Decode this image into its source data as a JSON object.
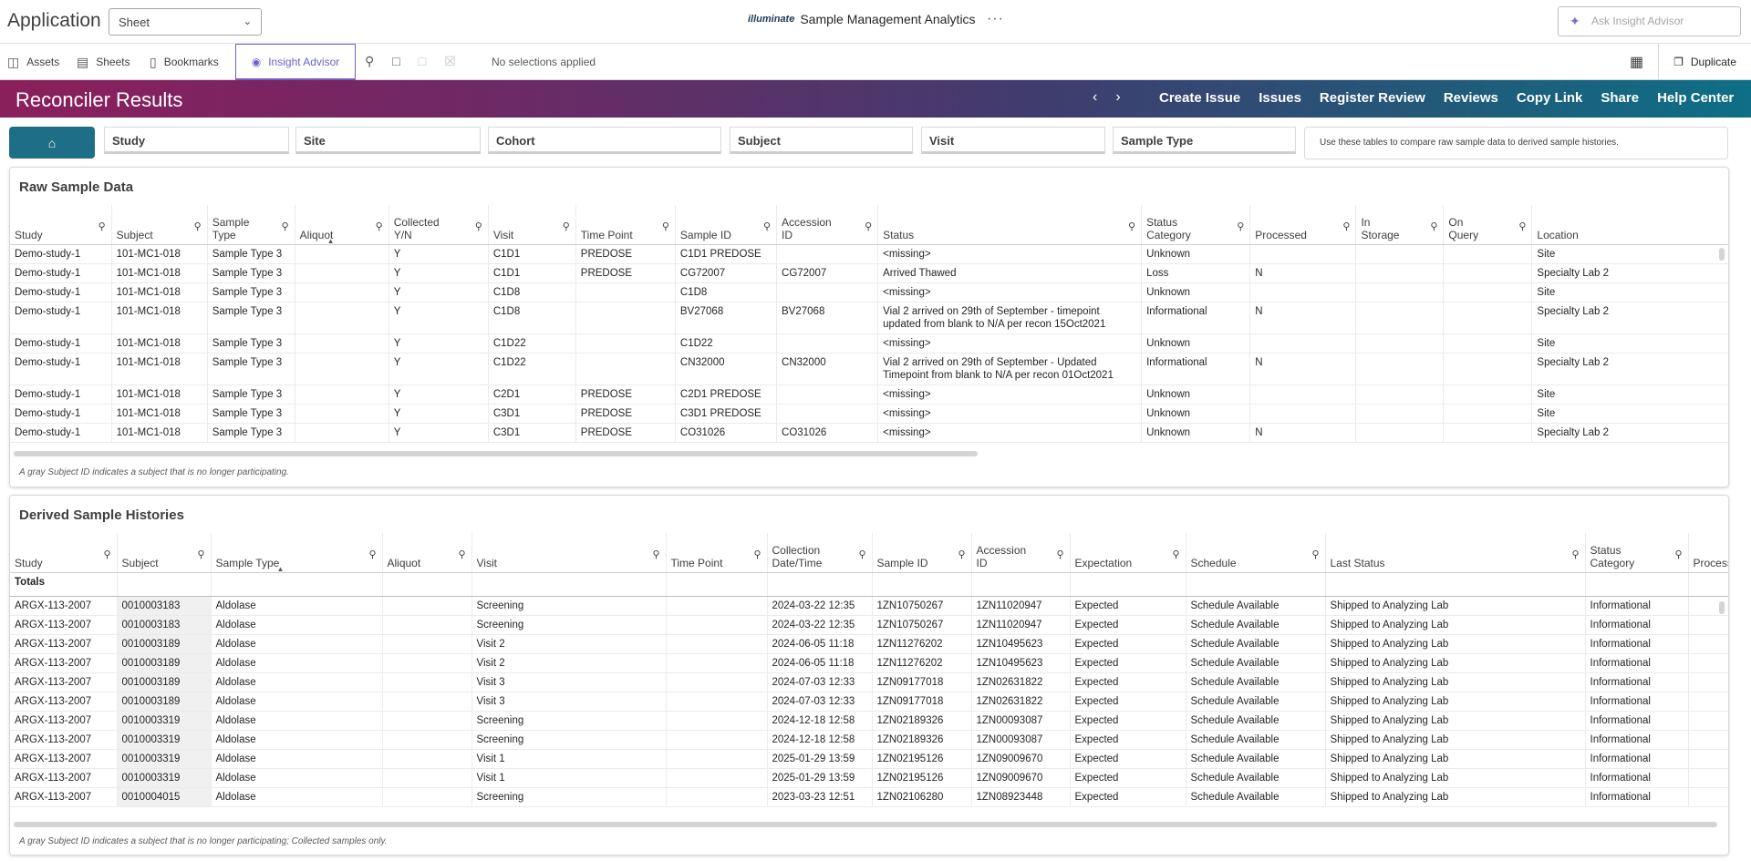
{
  "app": {
    "name": "Application",
    "sheet_value": "Sheet",
    "brand_logo": "illuminate",
    "title": "Sample Management Analytics",
    "ask_placeholder": "Ask Insight Advisor"
  },
  "toolbar": {
    "assets": "Assets",
    "sheets": "Sheets",
    "bookmarks": "Bookmarks",
    "insight": "Insight Advisor",
    "no_selections": "No selections applied",
    "duplicate": "Duplicate"
  },
  "banner": {
    "title": "Reconciler Results",
    "links": [
      "Create Issue",
      "Issues",
      "Register Review",
      "Reviews",
      "Copy Link",
      "Share",
      "Help Center"
    ]
  },
  "filters": {
    "items": [
      "Study",
      "Site",
      "Cohort",
      "Subject",
      "Visit",
      "Sample Type"
    ],
    "hint": "Use these tables to compare raw sample data to derived sample histories."
  },
  "raw": {
    "title": "Raw Sample Data",
    "footnote": "A gray Subject ID indicates a subject that is no longer participating.",
    "columns": [
      "Study",
      "Subject",
      "Sample Type",
      "Aliquot",
      "Collected Y/N",
      "Visit",
      "Time Point",
      "Sample ID",
      "Accession ID",
      "Status",
      "Status Category",
      "Processed",
      "In Storage",
      "On Query",
      "Location"
    ],
    "rows": [
      [
        "Demo-study-1",
        "101-MC1-018",
        "Sample Type 3",
        "",
        "Y",
        "C1D1",
        "PREDOSE",
        "C1D1 PREDOSE",
        "",
        "<missing>",
        "Unknown",
        "",
        "",
        "",
        "Site"
      ],
      [
        "Demo-study-1",
        "101-MC1-018",
        "Sample Type 3",
        "",
        "Y",
        "C1D1",
        "PREDOSE",
        "CG72007",
        "CG72007",
        "Arrived Thawed",
        "Loss",
        "N",
        "",
        "",
        "Specialty Lab 2"
      ],
      [
        "Demo-study-1",
        "101-MC1-018",
        "Sample Type 3",
        "",
        "Y",
        "C1D8",
        "",
        "C1D8",
        "",
        "<missing>",
        "Unknown",
        "",
        "",
        "",
        "Site"
      ],
      [
        "Demo-study-1",
        "101-MC1-018",
        "Sample Type 3",
        "",
        "Y",
        "C1D8",
        "",
        "BV27068",
        "BV27068",
        "Vial 2 arrived on 29th of September - timepoint updated from blank to N/A per recon 15Oct2021",
        "Informational",
        "N",
        "",
        "",
        "Specialty Lab 2"
      ],
      [
        "Demo-study-1",
        "101-MC1-018",
        "Sample Type 3",
        "",
        "Y",
        "C1D22",
        "",
        "C1D22",
        "",
        "<missing>",
        "Unknown",
        "",
        "",
        "",
        "Site"
      ],
      [
        "Demo-study-1",
        "101-MC1-018",
        "Sample Type 3",
        "",
        "Y",
        "C1D22",
        "",
        "CN32000",
        "CN32000",
        "Vial 2 arrived on 29th of September - Updated Timepoint from blank to N/A per recon 01Oct2021",
        "Informational",
        "N",
        "",
        "",
        "Specialty Lab 2"
      ],
      [
        "Demo-study-1",
        "101-MC1-018",
        "Sample Type 3",
        "",
        "Y",
        "C2D1",
        "PREDOSE",
        "C2D1 PREDOSE",
        "",
        "<missing>",
        "Unknown",
        "",
        "",
        "",
        "Site"
      ],
      [
        "Demo-study-1",
        "101-MC1-018",
        "Sample Type 3",
        "",
        "Y",
        "C3D1",
        "PREDOSE",
        "C3D1 PREDOSE",
        "",
        "<missing>",
        "Unknown",
        "",
        "",
        "",
        "Site"
      ],
      [
        "Demo-study-1",
        "101-MC1-018",
        "Sample Type 3",
        "",
        "Y",
        "C3D1",
        "PREDOSE",
        "CO31026",
        "CO31026",
        "<missing>",
        "Unknown",
        "N",
        "",
        "",
        "Specialty Lab 2"
      ]
    ]
  },
  "derived": {
    "title": "Derived Sample Histories",
    "footnote": "A gray Subject ID indicates a subject that is no longer participating; Collected samples only.",
    "columns": [
      "Study",
      "Subject",
      "Sample Type",
      "Aliquot",
      "Visit",
      "Time Point",
      "Collection Date/Time",
      "Sample ID",
      "Accession ID",
      "Expectation",
      "Schedule",
      "Last Status",
      "Status Category",
      "Process"
    ],
    "totals_label": "Totals",
    "rows": [
      [
        "ARGX-113-2007",
        "0010003183",
        "Aldolase",
        "",
        "Screening",
        "",
        "2024-03-22 12:35",
        "1ZN10750267",
        "1ZN11020947",
        "Expected",
        "Schedule Available",
        "Shipped to Analyzing Lab",
        "Informational",
        ""
      ],
      [
        "ARGX-113-2007",
        "0010003183",
        "Aldolase",
        "",
        "Screening",
        "",
        "2024-03-22 12:35",
        "1ZN10750267",
        "1ZN11020947",
        "Expected",
        "Schedule Available",
        "Shipped to Analyzing Lab",
        "Informational",
        ""
      ],
      [
        "ARGX-113-2007",
        "0010003189",
        "Aldolase",
        "",
        "Visit 2",
        "",
        "2024-06-05 11:18",
        "1ZN11276202",
        "1ZN10495623",
        "Expected",
        "Schedule Available",
        "Shipped to Analyzing Lab",
        "Informational",
        ""
      ],
      [
        "ARGX-113-2007",
        "0010003189",
        "Aldolase",
        "",
        "Visit 2",
        "",
        "2024-06-05 11:18",
        "1ZN11276202",
        "1ZN10495623",
        "Expected",
        "Schedule Available",
        "Shipped to Analyzing Lab",
        "Informational",
        ""
      ],
      [
        "ARGX-113-2007",
        "0010003189",
        "Aldolase",
        "",
        "Visit 3",
        "",
        "2024-07-03 12:33",
        "1ZN09177018",
        "1ZN02631822",
        "Expected",
        "Schedule Available",
        "Shipped to Analyzing Lab",
        "Informational",
        ""
      ],
      [
        "ARGX-113-2007",
        "0010003189",
        "Aldolase",
        "",
        "Visit 3",
        "",
        "2024-07-03 12:33",
        "1ZN09177018",
        "1ZN02631822",
        "Expected",
        "Schedule Available",
        "Shipped to Analyzing Lab",
        "Informational",
        ""
      ],
      [
        "ARGX-113-2007",
        "0010003319",
        "Aldolase",
        "",
        "Screening",
        "",
        "2024-12-18 12:58",
        "1ZN02189326",
        "1ZN00093087",
        "Expected",
        "Schedule Available",
        "Shipped to Analyzing Lab",
        "Informational",
        ""
      ],
      [
        "ARGX-113-2007",
        "0010003319",
        "Aldolase",
        "",
        "Screening",
        "",
        "2024-12-18 12:58",
        "1ZN02189326",
        "1ZN00093087",
        "Expected",
        "Schedule Available",
        "Shipped to Analyzing Lab",
        "Informational",
        ""
      ],
      [
        "ARGX-113-2007",
        "0010003319",
        "Aldolase",
        "",
        "Visit 1",
        "",
        "2025-01-29 13:59",
        "1ZN02195126",
        "1ZN09009670",
        "Expected",
        "Schedule Available",
        "Shipped to Analyzing Lab",
        "Informational",
        ""
      ],
      [
        "ARGX-113-2007",
        "0010003319",
        "Aldolase",
        "",
        "Visit 1",
        "",
        "2025-01-29 13:59",
        "1ZN02195126",
        "1ZN09009670",
        "Expected",
        "Schedule Available",
        "Shipped to Analyzing Lab",
        "Informational",
        ""
      ],
      [
        "ARGX-113-2007",
        "0010004015",
        "Aldolase",
        "",
        "Screening",
        "",
        "2023-03-23 12:51",
        "1ZN02106280",
        "1ZN08923448",
        "Expected",
        "Schedule Available",
        "Shipped to Analyzing Lab",
        "Informational",
        ""
      ]
    ]
  }
}
